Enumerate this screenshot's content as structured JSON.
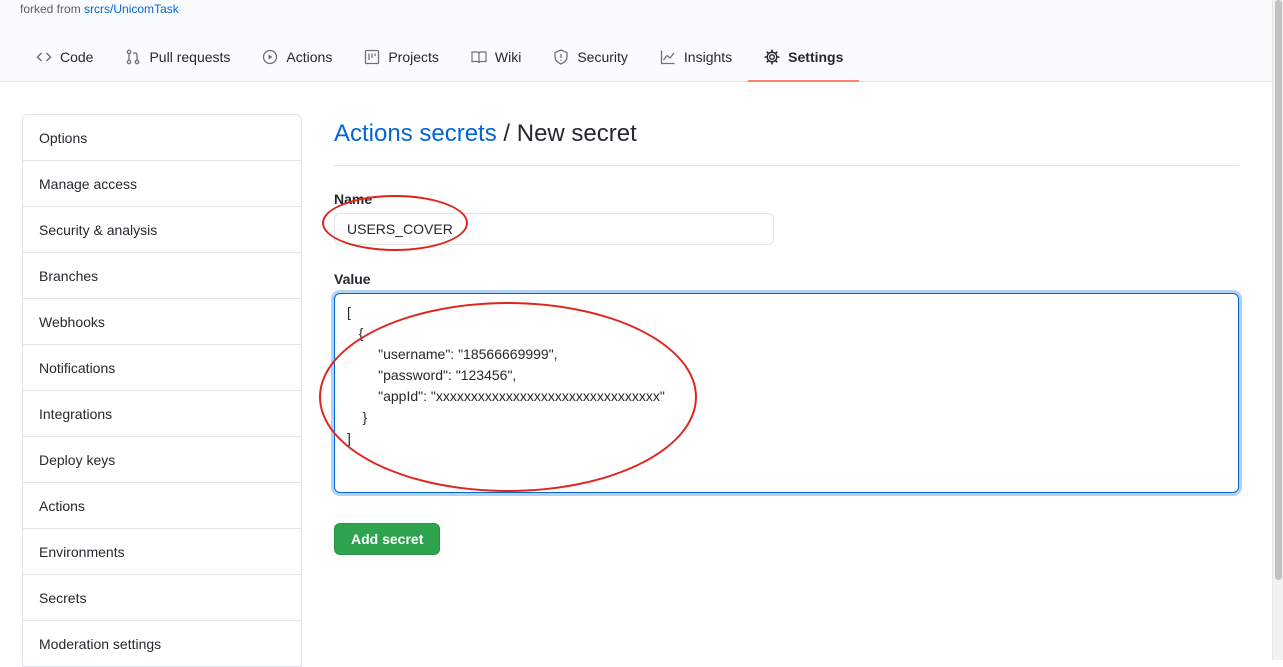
{
  "header": {
    "forked_prefix": "forked from",
    "forked_repo": "srcrs/UnicomTask",
    "tabs": [
      {
        "label": "Code",
        "icon": "code-icon"
      },
      {
        "label": "Pull requests",
        "icon": "pull-request-icon"
      },
      {
        "label": "Actions",
        "icon": "play-icon"
      },
      {
        "label": "Projects",
        "icon": "project-icon"
      },
      {
        "label": "Wiki",
        "icon": "book-icon"
      },
      {
        "label": "Security",
        "icon": "shield-icon"
      },
      {
        "label": "Insights",
        "icon": "graph-icon"
      },
      {
        "label": "Settings",
        "icon": "gear-icon"
      }
    ],
    "selected_tab": "Settings"
  },
  "sidebar": {
    "items": [
      {
        "label": "Options"
      },
      {
        "label": "Manage access"
      },
      {
        "label": "Security & analysis"
      },
      {
        "label": "Branches"
      },
      {
        "label": "Webhooks"
      },
      {
        "label": "Notifications"
      },
      {
        "label": "Integrations"
      },
      {
        "label": "Deploy keys"
      },
      {
        "label": "Actions"
      },
      {
        "label": "Environments"
      },
      {
        "label": "Secrets"
      },
      {
        "label": "Moderation settings"
      }
    ]
  },
  "main": {
    "breadcrumb_link": "Actions secrets",
    "breadcrumb_separator": "/",
    "page_title": "New secret",
    "name_label": "Name",
    "name_value": "USERS_COVER",
    "value_label": "Value",
    "value_text": "[\n   {\n        \"username\": \"18566669999\",\n        \"password\": \"123456\",\n        \"appId\": \"xxxxxxxxxxxxxxxxxxxxxxxxxxxxxxxx\"\n    }\n]",
    "submit_label": "Add secret"
  },
  "colors": {
    "link": "#0366d6",
    "selected_tab_underline": "#f9826c",
    "primary_button": "#2ea44f",
    "annotation": "#e0241b"
  }
}
